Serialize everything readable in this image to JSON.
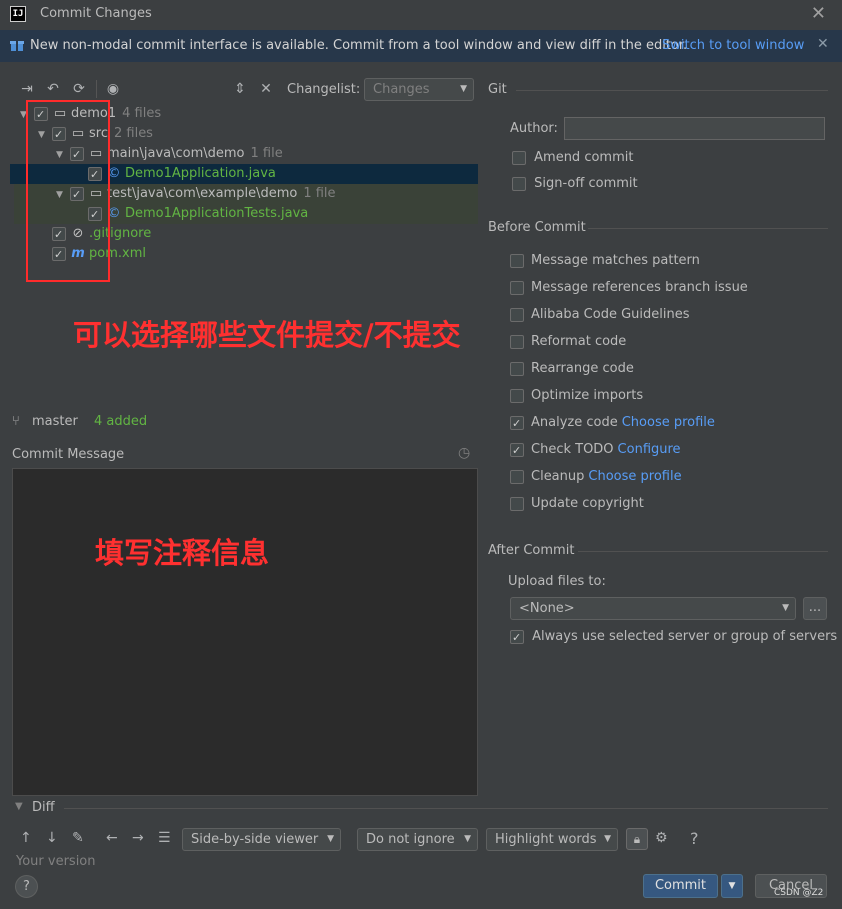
{
  "window": {
    "title": "Commit Changes",
    "close_glyph": "✕"
  },
  "banner": {
    "text": "New non-modal commit interface is available. Commit from a tool window and view diff in the editor.",
    "link": "Switch to tool window",
    "close_glyph": "✕"
  },
  "changelist": {
    "label": "Changelist:",
    "value": "Changes"
  },
  "tree": [
    {
      "name": "demo1",
      "count": "4 files",
      "indent": 0,
      "icon": "module-folder-icon",
      "checked": true,
      "style": "normal"
    },
    {
      "name": "src",
      "count": "2 files",
      "indent": 1,
      "icon": "folder-icon",
      "checked": true,
      "style": "normal"
    },
    {
      "name": "main\\java\\com\\demo",
      "count": "1 file",
      "indent": 2,
      "icon": "folder-icon",
      "checked": true,
      "style": "normal"
    },
    {
      "name": "Demo1Application.java",
      "count": "",
      "indent": 3,
      "icon": "java-class-icon",
      "checked": true,
      "style": "selected"
    },
    {
      "name": "test\\java\\com\\example\\demo",
      "count": "1 file",
      "indent": 2,
      "icon": "folder-icon",
      "checked": true,
      "style": "group"
    },
    {
      "name": "Demo1ApplicationTests.java",
      "count": "",
      "indent": 3,
      "icon": "java-class-icon",
      "checked": true,
      "style": "group"
    },
    {
      "name": ".gitignore",
      "count": "",
      "indent": 1,
      "icon": "ignore-icon",
      "checked": true,
      "style": "normal"
    },
    {
      "name": "pom.xml",
      "count": "",
      "indent": 1,
      "icon": "maven-icon",
      "checked": true,
      "style": "normal"
    }
  ],
  "annotations": {
    "files": "可以选择哪些文件提交/不提交",
    "message": "填写注释信息"
  },
  "status": {
    "branch": "master",
    "added": "4 added"
  },
  "commit_message": {
    "label": "Commit Message",
    "value": ""
  },
  "git": {
    "title": "Git",
    "author_label": "Author:",
    "author_value": "",
    "amend": "Amend commit",
    "signoff": "Sign-off commit"
  },
  "before_commit": {
    "title": "Before Commit",
    "options": [
      {
        "label": "Message matches pattern",
        "checked": false,
        "link": ""
      },
      {
        "label": "Message references branch issue",
        "checked": false,
        "link": ""
      },
      {
        "label": "Alibaba Code Guidelines",
        "checked": false,
        "link": ""
      },
      {
        "label": "Reformat code",
        "checked": false,
        "link": ""
      },
      {
        "label": "Rearrange code",
        "checked": false,
        "link": ""
      },
      {
        "label": "Optimize imports",
        "checked": false,
        "link": ""
      },
      {
        "label": "Analyze code",
        "checked": true,
        "link": "Choose profile"
      },
      {
        "label": "Check TODO",
        "checked": true,
        "link": "Configure"
      },
      {
        "label": "Cleanup",
        "checked": false,
        "link": "Choose profile"
      },
      {
        "label": "Update copyright",
        "checked": false,
        "link": ""
      }
    ]
  },
  "after_commit": {
    "title": "After Commit",
    "upload_label": "Upload files to:",
    "upload_value": "<None>",
    "browse": "...",
    "always_use": "Always use selected server or group of servers"
  },
  "diff": {
    "title": "Diff",
    "viewer": "Side-by-side viewer",
    "ignore": "Do not ignore",
    "highlight": "Highlight words",
    "your_version": "Your version",
    "help": "?"
  },
  "footer": {
    "help": "?",
    "commit": "Commit",
    "cancel": "Cancel",
    "watermark": "CSDN @Z2"
  },
  "colors": {
    "accent": "#589df6",
    "annotation": "#ff3030",
    "added": "#62b543"
  }
}
